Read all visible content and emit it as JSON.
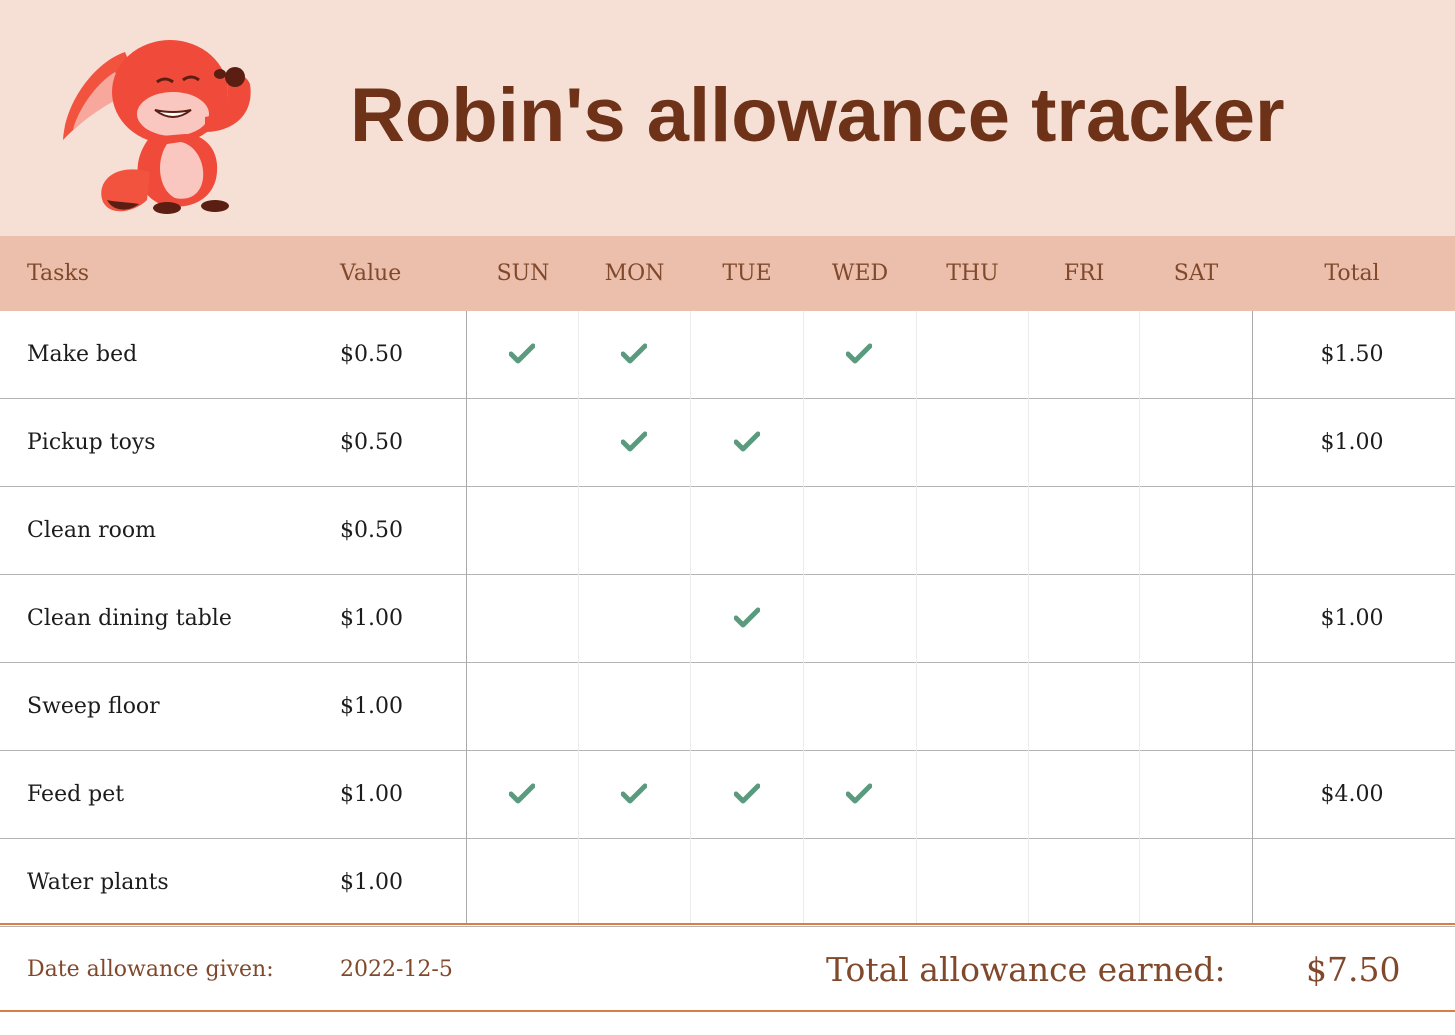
{
  "header": {
    "title": "Robin's allowance tracker",
    "mascot_icon": "fox-flexing-icon"
  },
  "colors": {
    "banner_bg": "#f6e0d6",
    "header_row_bg": "#ebbfab",
    "title": "#6e3218",
    "header_text": "#80492c",
    "check": "#5a9a7e",
    "accent_line": "#d87f48"
  },
  "table": {
    "columns": {
      "tasks": "Tasks",
      "value": "Value",
      "days": [
        "SUN",
        "MON",
        "TUE",
        "WED",
        "THU",
        "FRI",
        "SAT"
      ],
      "total": "Total"
    },
    "rows": [
      {
        "task": "Make bed",
        "value": "$0.50",
        "checks": [
          true,
          true,
          false,
          true,
          false,
          false,
          false
        ],
        "total": "$1.50"
      },
      {
        "task": "Pickup toys",
        "value": "$0.50",
        "checks": [
          false,
          true,
          true,
          false,
          false,
          false,
          false
        ],
        "total": "$1.00"
      },
      {
        "task": "Clean room",
        "value": "$0.50",
        "checks": [
          false,
          false,
          false,
          false,
          false,
          false,
          false
        ],
        "total": ""
      },
      {
        "task": "Clean dining table",
        "value": "$1.00",
        "checks": [
          false,
          false,
          true,
          false,
          false,
          false,
          false
        ],
        "total": "$1.00"
      },
      {
        "task": "Sweep floor",
        "value": "$1.00",
        "checks": [
          false,
          false,
          false,
          false,
          false,
          false,
          false
        ],
        "total": ""
      },
      {
        "task": "Feed pet",
        "value": "$1.00",
        "checks": [
          true,
          true,
          true,
          true,
          false,
          false,
          false
        ],
        "total": "$4.00"
      },
      {
        "task": "Water plants",
        "value": "$1.00",
        "checks": [
          false,
          false,
          false,
          false,
          false,
          false,
          false
        ],
        "total": ""
      }
    ]
  },
  "footer": {
    "date_label": "Date allowance given:",
    "date_value": "2022-12-5",
    "total_label": "Total allowance earned:",
    "total_value": "$7.50"
  }
}
